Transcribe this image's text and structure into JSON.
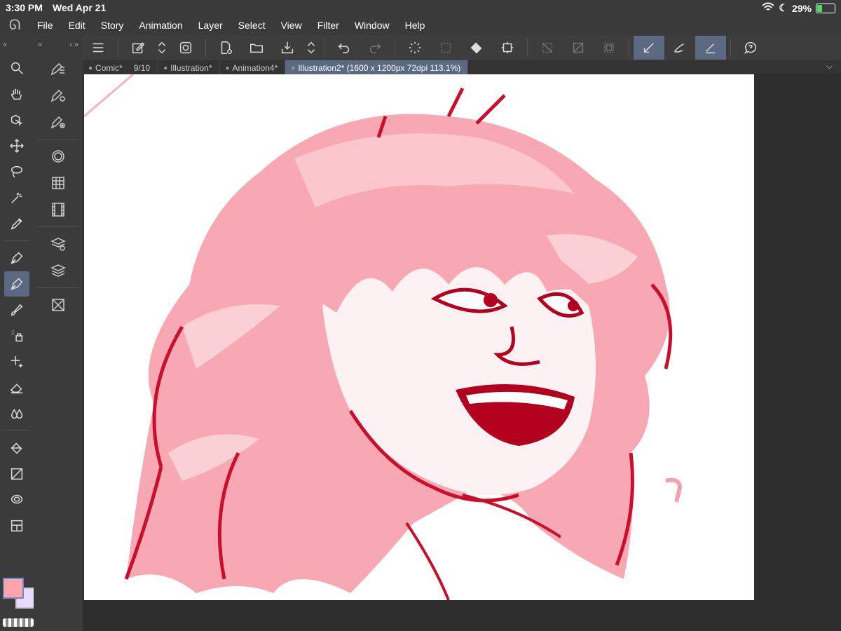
{
  "status": {
    "time": "3:30 PM",
    "date": "Wed Apr 21",
    "battery": "29%",
    "battery_level": 0.29
  },
  "menu": [
    "File",
    "Edit",
    "Story",
    "Animation",
    "Layer",
    "Select",
    "View",
    "Filter",
    "Window",
    "Help"
  ],
  "tabs": [
    {
      "label": "Comic*",
      "pages": "9/10"
    },
    {
      "label": "Illustration*"
    },
    {
      "label": "Animation4*"
    },
    {
      "label": "Illustration2* (1600 x 1200px 72dpi 113.1%)"
    }
  ],
  "colors": {
    "foreground": "#ffa3ad",
    "background": "#e7dcff",
    "accent": "#5b6a82"
  }
}
